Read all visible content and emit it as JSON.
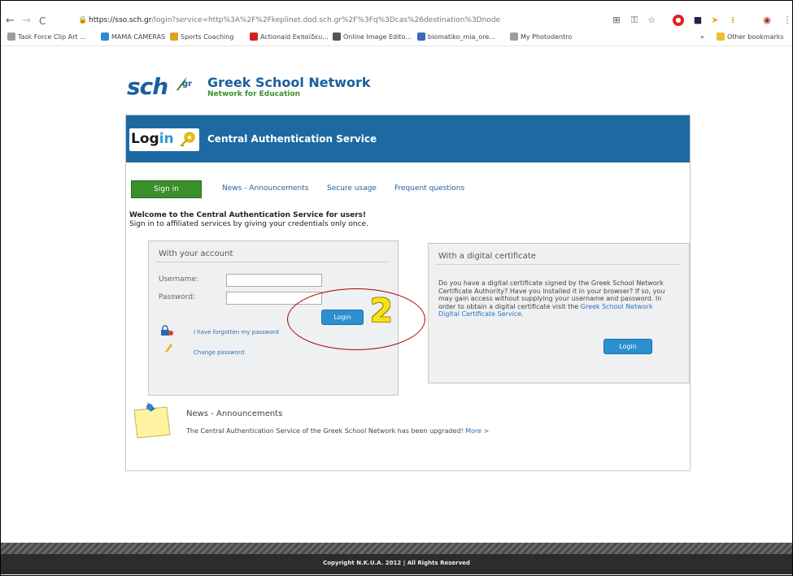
{
  "browser": {
    "url_host": "https://sso.sch.gr",
    "url_rest": "/login?service=http%3A%2F%2Fkeplinet.dod.sch.gr%2F%3Fq%3Dcas%26destination%3Dnode",
    "bookmarks": [
      {
        "label": "Task Force Clip Art ...",
        "icon_color": "#9e9e9e"
      },
      {
        "label": "MAMA CAMERAS",
        "icon_color": "#2a8bd6"
      },
      {
        "label": "Sports Coaching",
        "icon_color": "#e0a020"
      },
      {
        "label": "Actionaid Εκπαίδευ...",
        "icon_color": "#d02020"
      },
      {
        "label": "Online Image Edito...",
        "icon_color": "#555555"
      },
      {
        "label": "biomatiko_mia_ore...",
        "icon_color": "#3a6ab8"
      },
      {
        "label": "My Photodentro",
        "icon_color": "#9e9e9e"
      }
    ],
    "bookmarks_overflow": "»",
    "other_bookmarks": "Other bookmarks"
  },
  "site": {
    "logo_sch": "sch",
    "logo_gr": "gr",
    "title": "Greek School Network",
    "subtitle": "Network for Education"
  },
  "header": {
    "badge_login": "Log",
    "badge_in": "in",
    "title": "Central Authentication Service"
  },
  "tabs": {
    "signin": "Sign in",
    "news": "News - Announcements",
    "secure": "Secure usage",
    "faq": "Frequent questions"
  },
  "welcome": {
    "line1": "Welcome to the Central Authentication Service for users!",
    "line2": "Sign in to affiliated services by giving your credentials only once."
  },
  "account": {
    "title": "With your account",
    "username_label": "Username:",
    "password_label": "Password:",
    "login_button": "Login",
    "forgot_link": "I have forgotten my password",
    "change_link": "Change password"
  },
  "certificate": {
    "title": "With a digital certificate",
    "text": "Do you have a digital certificate signed by the Greek School Network Certificate Authority? Have you installed it in your browser? If so, you may gain access without supplying your username and password. In order to obtain a digital certificate visit the",
    "link": "Greek School Network Digital Certificate Service.",
    "login_button": "Login"
  },
  "news": {
    "title": "News - Announcements",
    "text": "The Central Authentication Service of the Greek School Network has been upgraded!",
    "more": "More >"
  },
  "footer": {
    "copyright": "Copyright N.K.U.A. 2012 | All Rights Reserved"
  },
  "annotation": {
    "step_number": "2",
    "color": "#b00000"
  },
  "colors": {
    "header_blue": "#1d6aa2",
    "signin_green": "#3b8f2a",
    "button_blue": "#2b8fd0"
  }
}
